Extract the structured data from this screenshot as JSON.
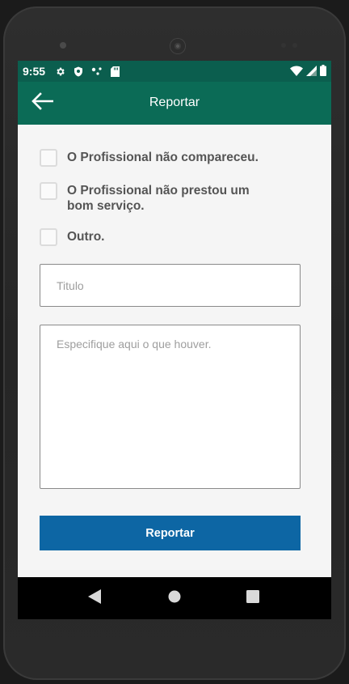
{
  "status_bar": {
    "time": "9:55",
    "icons": [
      "gear-icon",
      "shield-icon",
      "dots-icon",
      "sd-card-icon"
    ],
    "right_icons": [
      "wifi-icon",
      "signal-icon",
      "battery-icon"
    ]
  },
  "app_bar": {
    "title": "Reportar",
    "back_icon": "arrow-left-icon"
  },
  "form": {
    "options": [
      {
        "label": "O Profissional não compareceu.",
        "checked": false
      },
      {
        "label": "O Profissional não prestou um bom serviço.",
        "checked": false
      },
      {
        "label": "Outro.",
        "checked": false
      }
    ],
    "title_placeholder": "Titulo",
    "description_placeholder": "Especifique aqui o que houver.",
    "submit_label": "Reportar"
  },
  "nav_bar": {
    "buttons": [
      "back-triangle-icon",
      "home-circle-icon",
      "recents-square-icon"
    ]
  },
  "colors": {
    "status_bar": "#0b5e4e",
    "app_bar": "#0b6b56",
    "button": "#0d66a4",
    "background": "#f5f5f5"
  }
}
